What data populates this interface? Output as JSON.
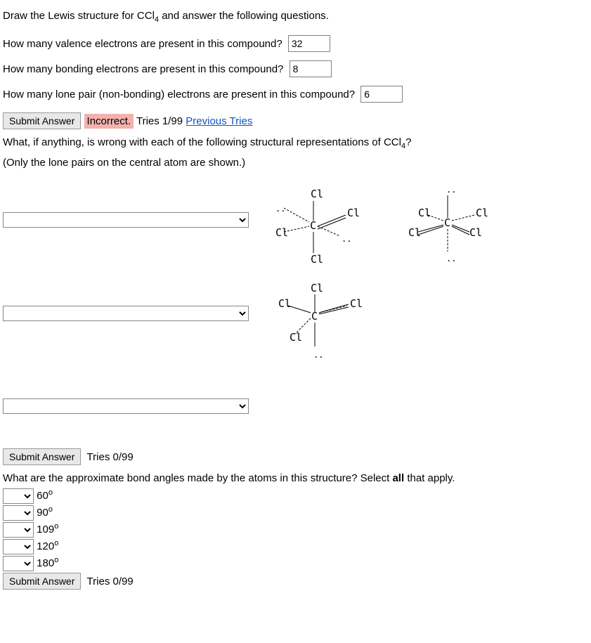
{
  "intro": {
    "prefix": "Draw the Lewis structure for CCl",
    "sub": "4",
    "suffix": " and answer the following questions."
  },
  "q1": {
    "text": "How many valence electrons are present in this compound?",
    "value": "32"
  },
  "q2": {
    "text": "How many bonding electrons are present in this compound?",
    "value": "8"
  },
  "q3": {
    "text": "How many lone pair (non-bonding) electrons are present in this compound?",
    "value": "6"
  },
  "feedback1": {
    "submit": "Submit Answer",
    "status": "Incorrect.",
    "tries": " Tries 1/99 ",
    "prev": "Previous Tries"
  },
  "struct_q": {
    "prefix": "What, if anything, is wrong with each of the following structural representations of CCl",
    "sub": "4",
    "suffix": "?",
    "line2": "(Only the lone pairs on the central atom are shown.)"
  },
  "feedback2": {
    "submit": "Submit Answer",
    "tries": "Tries 0/99"
  },
  "angles_q": {
    "prefix": "What are the approximate bond angles made by the atoms in this structure? Select ",
    "bold": "all",
    "suffix": " that apply."
  },
  "angles": {
    "opt1": "60",
    "opt2": "90",
    "opt3": "109",
    "opt4": "120",
    "opt5": "180",
    "deg": "o"
  },
  "feedback3": {
    "submit": "Submit Answer",
    "tries": "Tries 0/99"
  }
}
